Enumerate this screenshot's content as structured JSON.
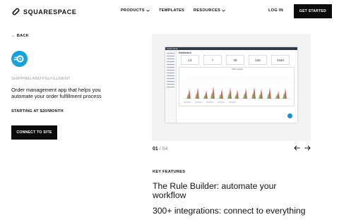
{
  "header": {
    "logo_text": "SQUARESPACE",
    "nav": [
      {
        "label": "PRODUCTS",
        "dropdown": true
      },
      {
        "label": "TEMPLATES",
        "dropdown": false
      },
      {
        "label": "RESOURCES",
        "dropdown": true
      }
    ],
    "login_label": "LOG IN",
    "cta_label": "GET STARTED"
  },
  "back_label": "← BACK",
  "extension": {
    "icon": "shipping-app-icon",
    "icon_color": "#1aa0d8",
    "category": "SHIPPING AND FULFILLMENT",
    "description": "Order management app that helps you automate your order fulfillment process",
    "price": "STARTING AT $20/MONTH",
    "connect_label": "CONNECT TO SITE"
  },
  "gallery": {
    "current": "01",
    "separator": "/",
    "total": "04",
    "prev_icon": "arrow-left-icon",
    "next_icon": "arrow-right-icon",
    "screenshot": {
      "brand": "Order Desk",
      "title": "Dashboard",
      "stats": [
        "13",
        "7",
        "38",
        "126",
        "3440"
      ],
      "chart_title": "Order Volume"
    }
  },
  "features": {
    "label": "KEY FEATURES",
    "items": [
      "The Rule Builder: automate your workflow",
      "300+ integrations: connect to everything"
    ]
  }
}
